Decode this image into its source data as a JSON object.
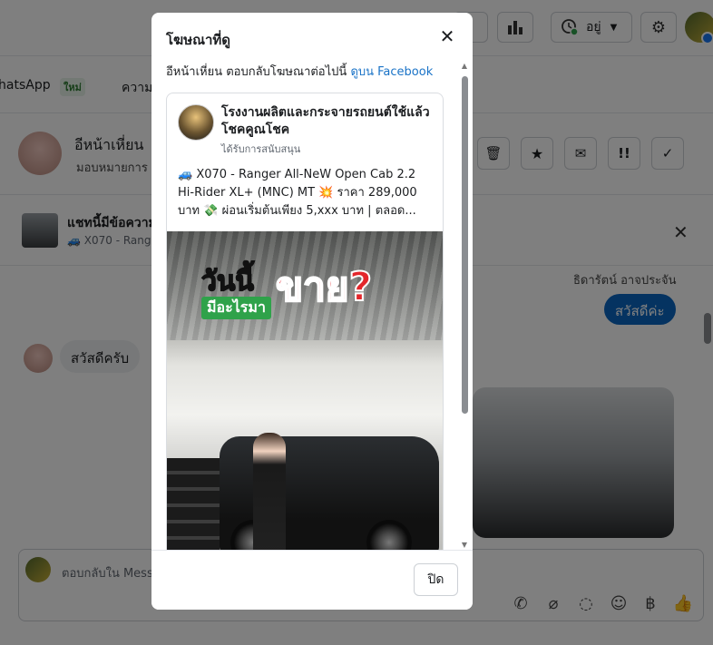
{
  "background": {
    "topbar": {
      "status_label": "อยู่"
    },
    "tabs": [
      {
        "label": "hatsApp"
      },
      {
        "label": "ใหม่"
      },
      {
        "label": "ความ"
      }
    ],
    "chat_header": {
      "name": "อีหน้าเหี่ยน",
      "subtitle": "มอบหมายการ"
    },
    "ad_strip": {
      "title": "แชทนี้มีข้อความ",
      "subtitle": "🚙 X070 - Range"
    },
    "messages": {
      "right_sender": "ธิดารัตน์ อาจประจัน",
      "right_text": "สวัสดีค่ะ",
      "left_text": "สวัสดีครับ"
    },
    "reply": {
      "placeholder": "ตอบกลับใน Mess"
    }
  },
  "modal": {
    "title": "โฆษณาที่ดู",
    "intro_text": "อีหน้าเหี่ยน ตอบกลับโฆษณาต่อไปนี้",
    "intro_link": "ดูบน Facebook",
    "ad": {
      "page_name": "โรงงานผลิตและกระจายรถยนต์ใช้แล้ว โชคคูณโชค",
      "sponsored": "ได้รับการสนับสนุน",
      "text": "🚙 X070 - Ranger All-NeW Open Cab 2.2 Hi-Rider XL+ (MNC) MT 💥 ราคา 289,000 บาท 💸 ผ่อนเริ่มต้นเพียง 5,xxx บาท | ตลอด...",
      "image_headline_1": "วันนี้",
      "image_headline_2": "ขาย?",
      "image_headline_3": "มีอะไรมา"
    },
    "close_button": "ปิด"
  }
}
